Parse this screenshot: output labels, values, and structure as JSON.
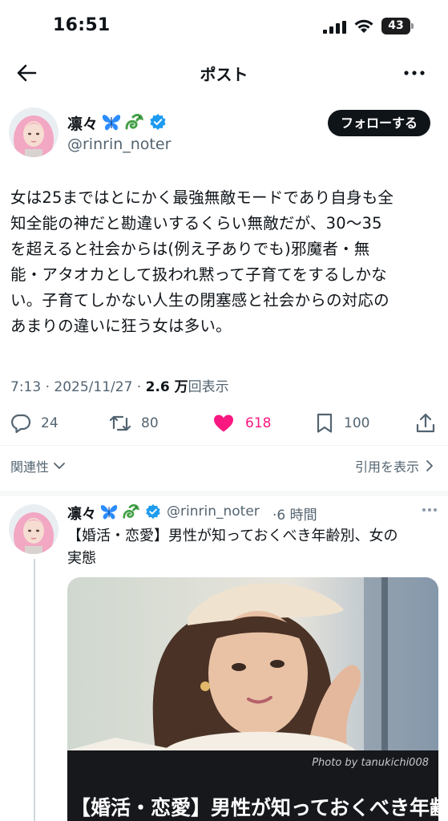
{
  "status_bar": {
    "time": "16:51",
    "battery": "43"
  },
  "nav": {
    "title": "ポスト"
  },
  "post": {
    "author_name": "凛々",
    "author_handle": "@rinrin_noter",
    "follow_label": "フォローする",
    "text": "女は25まではとにかく最強無敵モードであり自身も全\n知全能の神だと勘違いするくらい無敵だが、30〜35\nを超えると社会からは(例え子ありでも)邪魔者・無\n能・アタオカとして扱われ黙って子育てをするしかな\nい。子育てしかない人生の閉塞感と社会からの対応の\nあまりの違いに狂う女は多い。",
    "time": "7:13",
    "sep1": " · ",
    "date": "2025/11/27",
    "sep2": " · ",
    "views_count": "2.6 万",
    "views_label": "回表示",
    "actions": {
      "replies": "24",
      "reposts": "80",
      "likes": "618",
      "bookmarks": "100"
    },
    "related_label": "関連性",
    "quotes_label": "引用を表示"
  },
  "reply": {
    "author_name": "凛々",
    "author_handle": "@rinrin_noter",
    "timeago": "·6 時間",
    "text": "【婚活・恋愛】男性が知っておくべき年齢別、女の\n実態",
    "card": {
      "photo_credit": "Photo by tanukichi008",
      "headline": "【婚活・恋愛】男性が知っておくべき年齢"
    }
  },
  "colors": {
    "text": "#0f1419",
    "secondary": "#536471",
    "like": "#f91880",
    "verified": "#1d9bf0",
    "divider": "#eff3f4"
  },
  "icons": [
    "signal-icon",
    "wifi-icon",
    "battery-icon",
    "back-icon",
    "more-icon",
    "butterfly-icon",
    "dragon-icon",
    "verified-icon",
    "reply-icon",
    "repost-icon",
    "heart-icon",
    "bookmark-icon",
    "share-icon",
    "chevron-down-icon",
    "chevron-right-icon"
  ]
}
